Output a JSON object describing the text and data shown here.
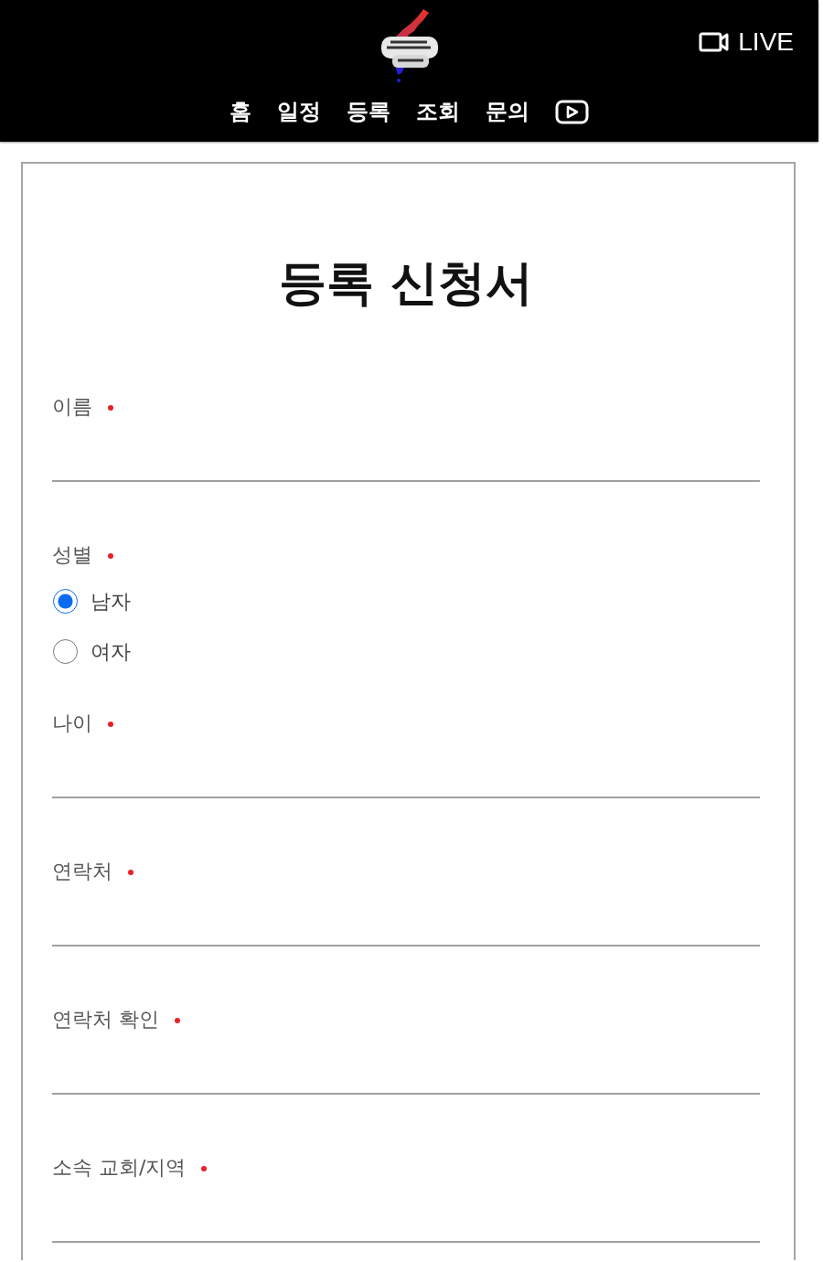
{
  "header": {
    "live": {
      "label": "LIVE"
    },
    "nav": [
      {
        "kind": "text",
        "label": "홈"
      },
      {
        "kind": "text",
        "label": "일정"
      },
      {
        "kind": "text",
        "label": "등록"
      },
      {
        "kind": "text",
        "label": "조회"
      },
      {
        "kind": "text",
        "label": "문의"
      },
      {
        "kind": "video"
      }
    ]
  },
  "form": {
    "title": "등록 신청서",
    "fields": [
      {
        "kind": "text",
        "label": "이름",
        "required": true
      },
      {
        "kind": "radio",
        "label": "성별",
        "required": true,
        "options": [
          {
            "label": "남자",
            "selected": true
          },
          {
            "label": "여자",
            "selected": false
          }
        ]
      },
      {
        "kind": "text",
        "label": "나이",
        "required": true
      },
      {
        "kind": "text",
        "label": "연락처",
        "required": true
      },
      {
        "kind": "text",
        "label": "연락처 확인",
        "required": true
      },
      {
        "kind": "text",
        "label": "소속 교회/지역",
        "required": true
      }
    ]
  }
}
